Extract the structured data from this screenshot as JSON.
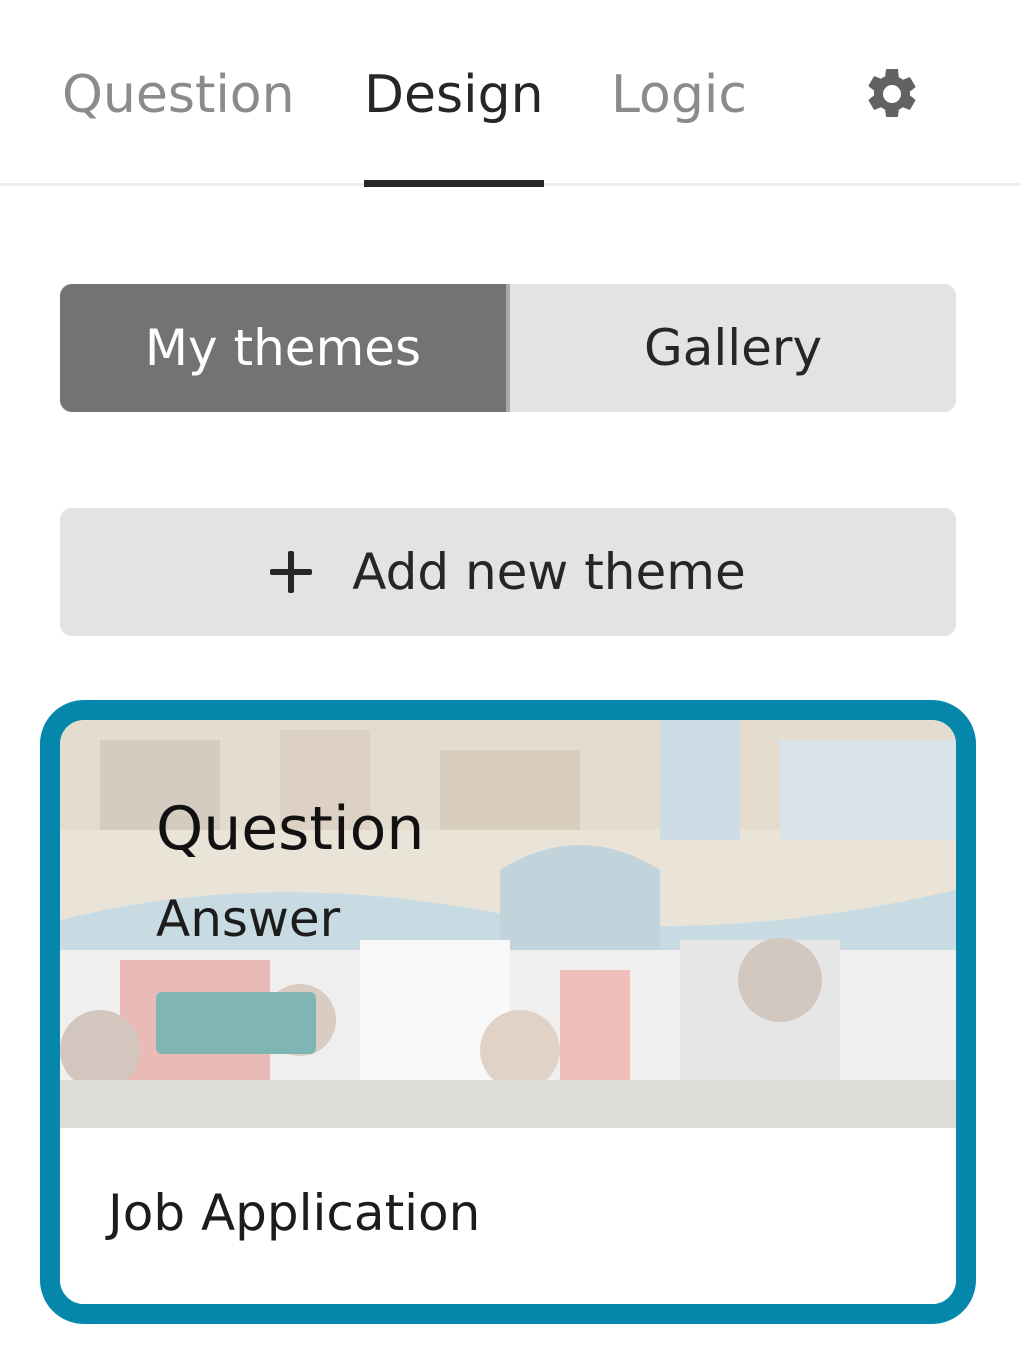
{
  "tabs": {
    "items": [
      {
        "label": "Question",
        "active": false
      },
      {
        "label": "Design",
        "active": true
      },
      {
        "label": "Logic",
        "active": false
      }
    ],
    "settings_icon": "gear-icon"
  },
  "theme_switch": {
    "options": [
      "My themes",
      "Gallery"
    ],
    "selected": "My themes"
  },
  "add_theme": {
    "label": "Add new theme",
    "icon": "plus-icon"
  },
  "theme_card": {
    "preview": {
      "question": "Question",
      "answer": "Answer",
      "button_color": "#7fb6b4"
    },
    "name": "Job Application",
    "selected": true,
    "border_color": "#0487aa"
  },
  "colors": {
    "text": "#262627",
    "muted_tab": "#8b8b8b",
    "segment_active": "#737373",
    "segment_bg": "#e3e3e3"
  }
}
